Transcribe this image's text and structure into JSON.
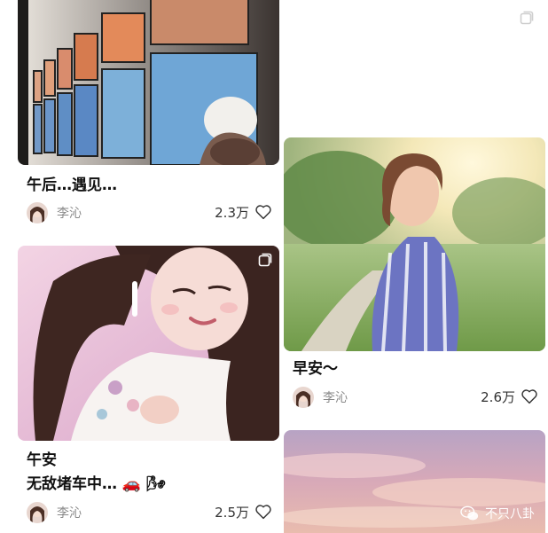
{
  "feed": [
    {
      "caption": [
        "午后…遇见…"
      ],
      "author": "李沁",
      "likes": "2.3万"
    },
    {
      "caption": [
        "午安",
        "无敌堵车中… 🚗 🌬"
      ],
      "author": "李沁",
      "likes": "2.5万"
    },
    {
      "caption": [
        "早安～"
      ],
      "author": "李沁",
      "likes": "2.6万"
    }
  ],
  "watermark": "不只八卦",
  "colors": {
    "accent_text": "#111111",
    "muted_text": "#888888",
    "icon_stroke": "#333333"
  }
}
